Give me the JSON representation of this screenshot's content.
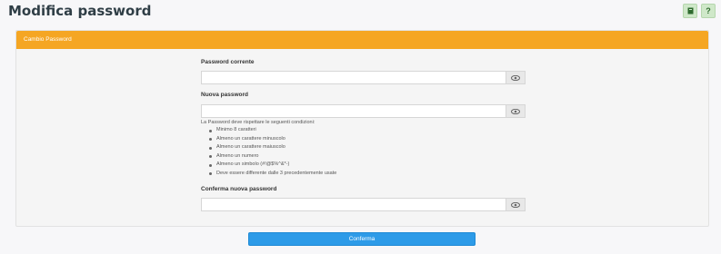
{
  "page": {
    "title": "Modifica password"
  },
  "top_actions": [
    {
      "icon": "notebook-icon",
      "glyph": "▪"
    },
    {
      "icon": "help-icon",
      "glyph": "?"
    }
  ],
  "card": {
    "header": "Cambio Password"
  },
  "fields": {
    "current": {
      "label": "Password corrente",
      "value": "",
      "placeholder": ""
    },
    "new": {
      "label": "Nuova password",
      "value": "",
      "placeholder": ""
    },
    "confirm": {
      "label": "Conferma nuova password",
      "value": "",
      "placeholder": ""
    }
  },
  "rules": {
    "intro": "La Password deve rispettare le seguenti condizioni:",
    "items": [
      "Minimo 8 caratteri",
      "Almeno un carattere minuscolo",
      "Almeno un carattere maiuscolo",
      "Almeno un numero",
      "Almeno un simbolo (#!@$%^&*-)",
      "Deve essere differente dalle 3 precedentemente usate"
    ]
  },
  "confirm_button": {
    "label": "Conferma"
  },
  "colors": {
    "header": "#f5a623",
    "primary": "#2d9be8",
    "icon_bg": "#cfe8c9"
  }
}
